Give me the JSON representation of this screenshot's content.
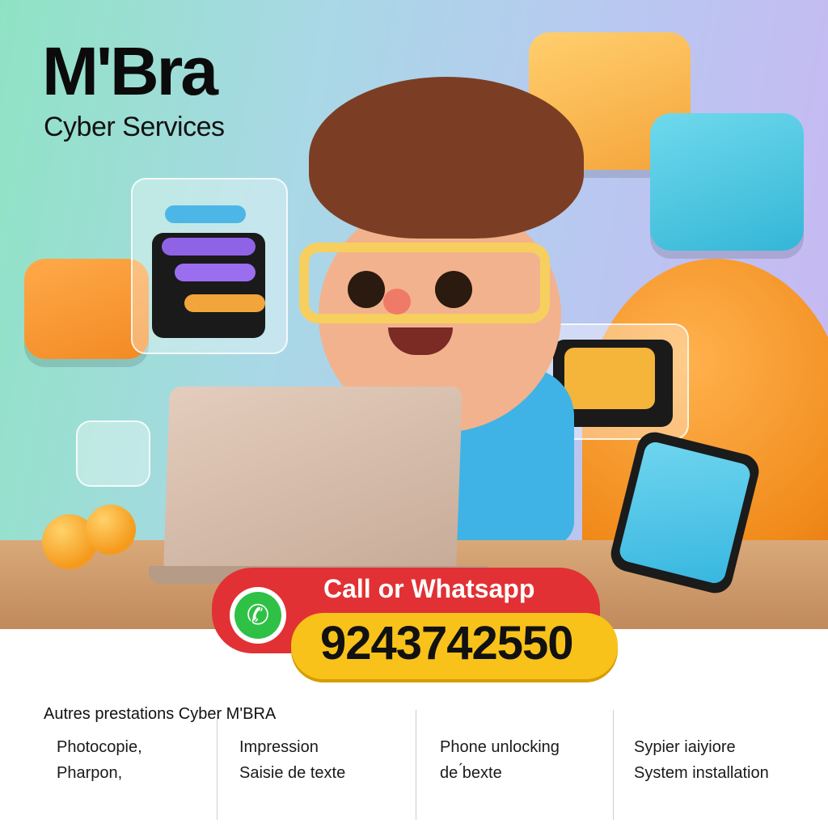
{
  "brand": {
    "title": "M'Bra",
    "subtitle": "Cyber Services"
  },
  "cta": {
    "label": "Call or Whatsapp",
    "phone": "9243742550",
    "whatsapp_icon": "whatsapp-icon"
  },
  "services": {
    "heading": "Autres prestations Cyber M'BRA",
    "columns": [
      [
        "Photocopie,",
        "Pharpon,"
      ],
      [
        "Impression",
        "Saisie de texte"
      ],
      [
        "Phone unlocking",
        "de ́bexte"
      ],
      [
        "Sypier  iaiyiore",
        "System installation"
      ]
    ]
  },
  "colors": {
    "cta_red": "#e23134",
    "cta_yellow": "#f8c21a",
    "whatsapp_green": "#2fc145"
  }
}
